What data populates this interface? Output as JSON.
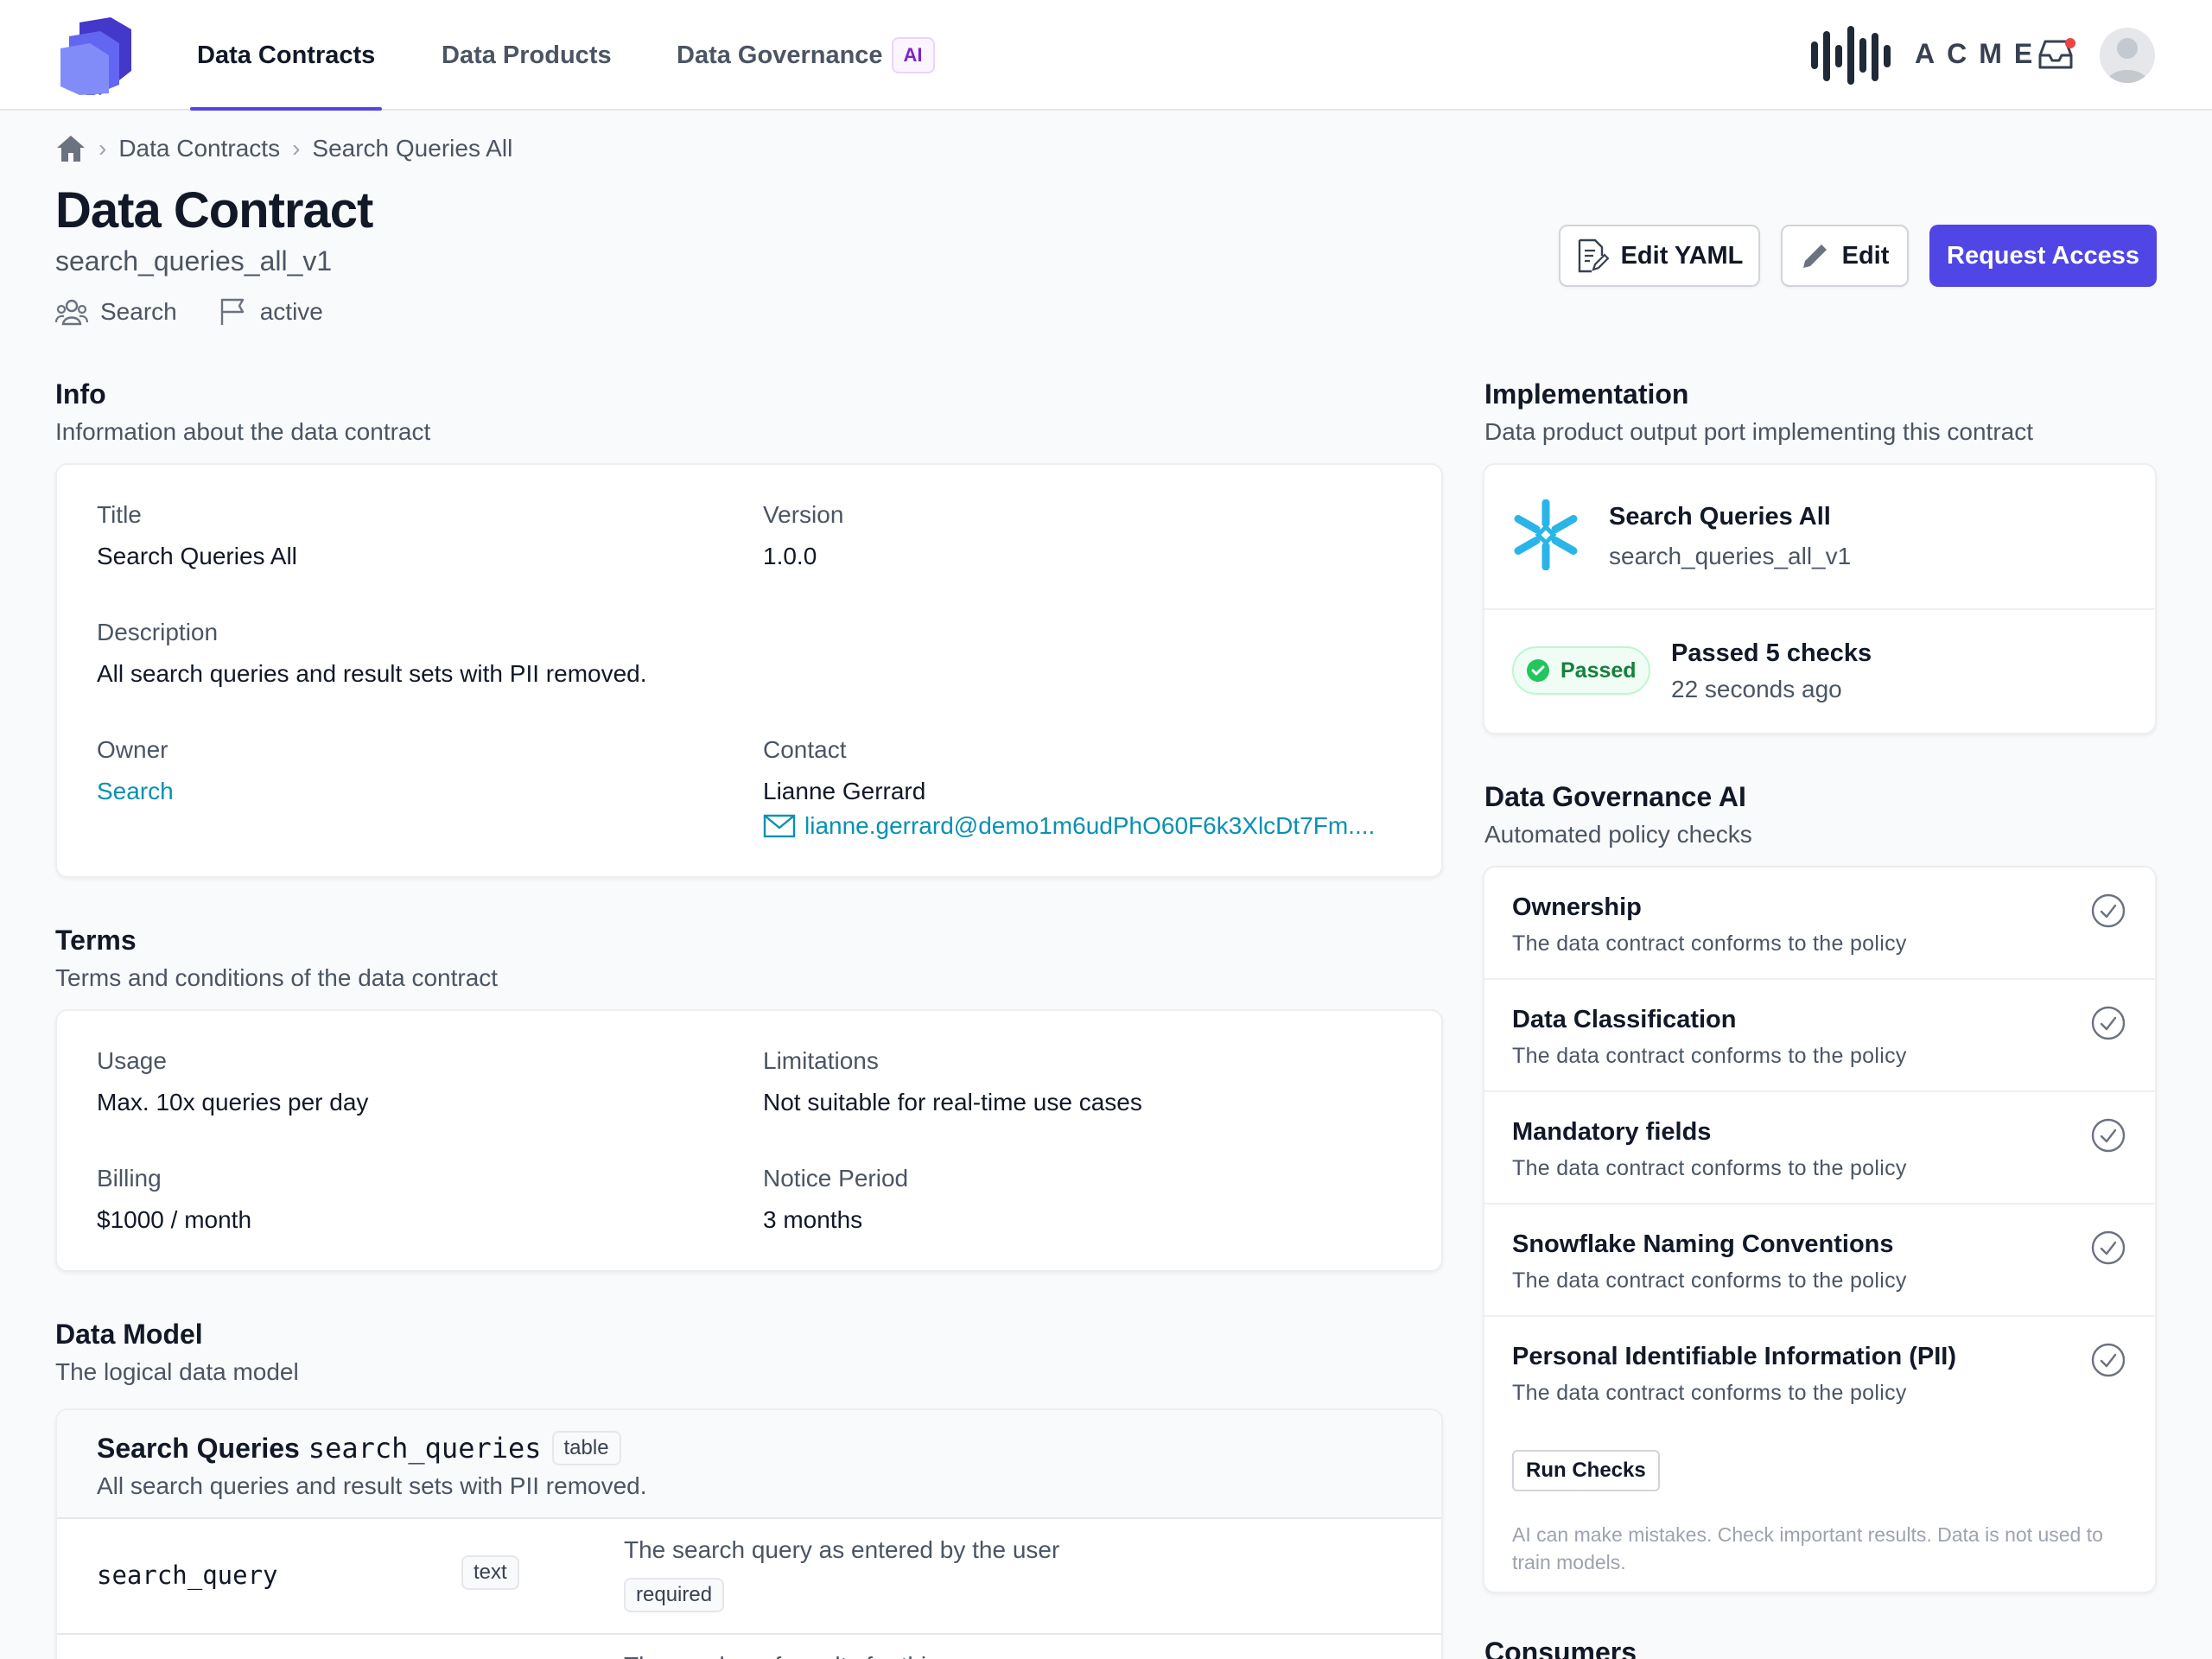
{
  "nav": {
    "items": [
      "Data Contracts",
      "Data Products",
      "Data Governance"
    ],
    "ai_badge": "AI",
    "brand": "ACME"
  },
  "breadcrumb": [
    "Data Contracts",
    "Search Queries All"
  ],
  "header": {
    "title": "Data Contract",
    "subtitle": "search_queries_all_v1",
    "team": "Search",
    "status": "active",
    "edit_yaml": "Edit YAML",
    "edit": "Edit",
    "request_access": "Request Access"
  },
  "info": {
    "heading": "Info",
    "subheading": "Information about the data contract",
    "title_label": "Title",
    "title_value": "Search Queries All",
    "version_label": "Version",
    "version_value": "1.0.0",
    "description_label": "Description",
    "description_value": "All search queries and result sets with PII removed.",
    "owner_label": "Owner",
    "owner_value": "Search",
    "contact_label": "Contact",
    "contact_name": "Lianne Gerrard",
    "contact_email": "lianne.gerrard@demo1m6udPhO60F6k3XlcDt7Fm...."
  },
  "terms": {
    "heading": "Terms",
    "subheading": "Terms and conditions of the data contract",
    "usage_label": "Usage",
    "usage_value": "Max. 10x queries per day",
    "limitations_label": "Limitations",
    "limitations_value": "Not suitable for real-time use cases",
    "billing_label": "Billing",
    "billing_value": "$1000 / month",
    "notice_label": "Notice Period",
    "notice_value": "3 months"
  },
  "data_model": {
    "heading": "Data Model",
    "subheading": "The logical data model",
    "model_title": "Search Queries",
    "model_name": "search_queries",
    "model_type": "table",
    "model_description": "All search queries and result sets with PII removed.",
    "fields": [
      {
        "name": "search_query",
        "type": "text",
        "description": "The search query as entered by the user",
        "tag": "required"
      },
      {
        "description": "The number of results for this query"
      }
    ]
  },
  "implementation": {
    "heading": "Implementation",
    "subheading": "Data product output port implementing this contract",
    "port_title": "Search Queries All",
    "port_name": "search_queries_all_v1",
    "status_badge": "Passed",
    "checks_text": "Passed 5 checks",
    "checks_time": "22 seconds ago"
  },
  "governance": {
    "heading": "Data Governance AI",
    "subheading": "Automated policy checks",
    "checks": [
      {
        "title": "Ownership",
        "description": "The data contract conforms to the policy"
      },
      {
        "title": "Data Classification",
        "description": "The data contract conforms to the policy"
      },
      {
        "title": "Mandatory fields",
        "description": "The data contract conforms to the policy"
      },
      {
        "title": "Snowflake Naming Conventions",
        "description": "The data contract conforms to the policy"
      },
      {
        "title": "Personal Identifiable Information (PII)",
        "description": "The data contract conforms to the policy"
      }
    ],
    "run_checks": "Run Checks",
    "disclaimer": "AI can make mistakes. Check important results. Data is not used to train models."
  },
  "consumers": {
    "heading": "Consumers"
  },
  "colors": {
    "accent": "#4f46e5",
    "link": "#0891b2",
    "success": "#22c55e",
    "snowflake": "#29b5e8"
  }
}
